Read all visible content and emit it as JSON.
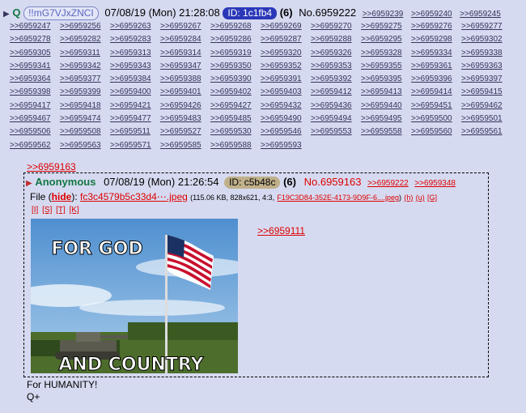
{
  "header": {
    "name": "Q",
    "tripcode": "!!mG7VJxZNCI",
    "date": "07/08/19 (Mon) 21:28:08",
    "id": "ID: 1c1fb4",
    "count": "(6)",
    "post_no": "No.6959222",
    "backlinks": [
      ">>6959239",
      ">>6959240",
      ">>6959245",
      ">>6959247",
      ">>6959256",
      ">>6959263",
      ">>6959267",
      ">>6959268",
      ">>6959269",
      ">>6959270",
      ">>6959275",
      ">>6959276",
      ">>6959277",
      ">>6959278",
      ">>6959282",
      ">>6959283",
      ">>6959284",
      ">>6959286",
      ">>6959287",
      ">>6959288",
      ">>6959295",
      ">>6959298",
      ">>6959302",
      ">>6959305",
      ">>6959311",
      ">>6959313",
      ">>6959314",
      ">>6959319",
      ">>6959320",
      ">>6959326",
      ">>6959328",
      ">>6959334",
      ">>6959338",
      ">>6959341",
      ">>6959342",
      ">>6959343",
      ">>6959347",
      ">>6959350",
      ">>6959352",
      ">>6959353",
      ">>6959355",
      ">>6959361",
      ">>6959363",
      ">>6959364",
      ">>6959377",
      ">>6959384",
      ">>6959388",
      ">>6959390",
      ">>6959391",
      ">>6959392",
      ">>6959395",
      ">>6959396",
      ">>6959397",
      ">>6959398",
      ">>6959399",
      ">>6959400",
      ">>6959401",
      ">>6959402",
      ">>6959403",
      ">>6959412",
      ">>6959413",
      ">>6959414",
      ">>6959415",
      ">>6959417",
      ">>6959418",
      ">>6959421",
      ">>6959426",
      ">>6959427",
      ">>6959432",
      ">>6959436",
      ">>6959440",
      ">>6959451",
      ">>6959462",
      ">>6959467",
      ">>6959474",
      ">>6959477",
      ">>6959483",
      ">>6959485",
      ">>6959490",
      ">>6959494",
      ">>6959495",
      ">>6959500",
      ">>6959501",
      ">>6959506",
      ">>6959508",
      ">>6959511",
      ">>6959527",
      ">>6959530",
      ">>6959546",
      ">>6959553",
      ">>6959558",
      ">>6959560",
      ">>6959561",
      ">>6959562",
      ">>6959563",
      ">>6959571",
      ">>6959585",
      ">>6959588",
      ">>6959593"
    ]
  },
  "quoted": {
    "link": ">>6959163",
    "name": "Anonymous",
    "date": "07/08/19 (Mon) 21:26:54",
    "id": "ID: c5b48c",
    "count": "(6)",
    "post_no": "No.6959163",
    "backlinks": [
      ">>6959222",
      ">>6959348"
    ],
    "file_label": "File (",
    "hide": "hide",
    "file_label_end": "):",
    "file_name": "fc3c4579b5c33d4⋯.jpeg",
    "file_info_prefix": "(115.06 KB, 828x621, 4:3,",
    "file_orig": "F19C3D84-352E-4173-9D9F-6....jpeg",
    "file_info_suffix": ")",
    "tools_line1": [
      "(h)",
      "(u)",
      "[G]"
    ],
    "tools_line2": [
      "[I]",
      "[S]",
      "[T]",
      "[K]"
    ],
    "image_text_top": "FOR GOD",
    "image_text_bottom": "AND COUNTRY",
    "body_quote": ">>6959111"
  },
  "reply_text": [
    "For HUMANITY!",
    "Q+"
  ]
}
